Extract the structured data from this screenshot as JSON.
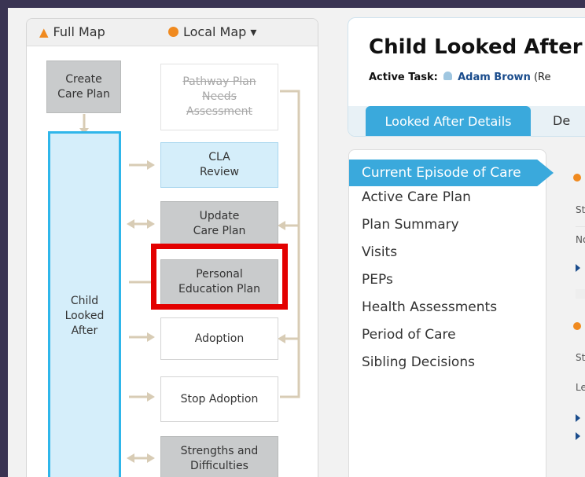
{
  "map_tabs": {
    "full_map": "Full Map",
    "local_map": "Local Map ▾"
  },
  "map_nodes": {
    "create_care_plan": "Create\nCare Plan",
    "pathway_plan": "Pathway Plan\nNeeds\nAssessment",
    "child_looked_after": "Child\nLooked\nAfter",
    "cla_review": "CLA\nReview",
    "update_care_plan": "Update\nCare Plan",
    "personal_education_plan": "Personal\nEducation Plan",
    "adoption": "Adoption",
    "stop_adoption": "Stop Adoption",
    "strengths_difficulties": "Strengths and\nDifficulties"
  },
  "header": {
    "title": "Child Looked After",
    "active_task_label": "Active Task:",
    "active_task_user": "Adam Brown",
    "active_task_suffix": "(Re",
    "tab_active": "Looked After Details",
    "tab_next": "De"
  },
  "menu": [
    "Current Episode of Care",
    "Active Care Plan",
    "Plan Summary",
    "Visits",
    "PEPs",
    "Health Assessments",
    "Period of Care",
    "Sibling Decisions"
  ],
  "right_strip": {
    "s1": "St",
    "s2": "No",
    "s3": "St",
    "s4": "Le"
  },
  "colors": {
    "accent": "#3aa9dc",
    "highlight": "#e30000",
    "dot": "#f08a1f"
  }
}
